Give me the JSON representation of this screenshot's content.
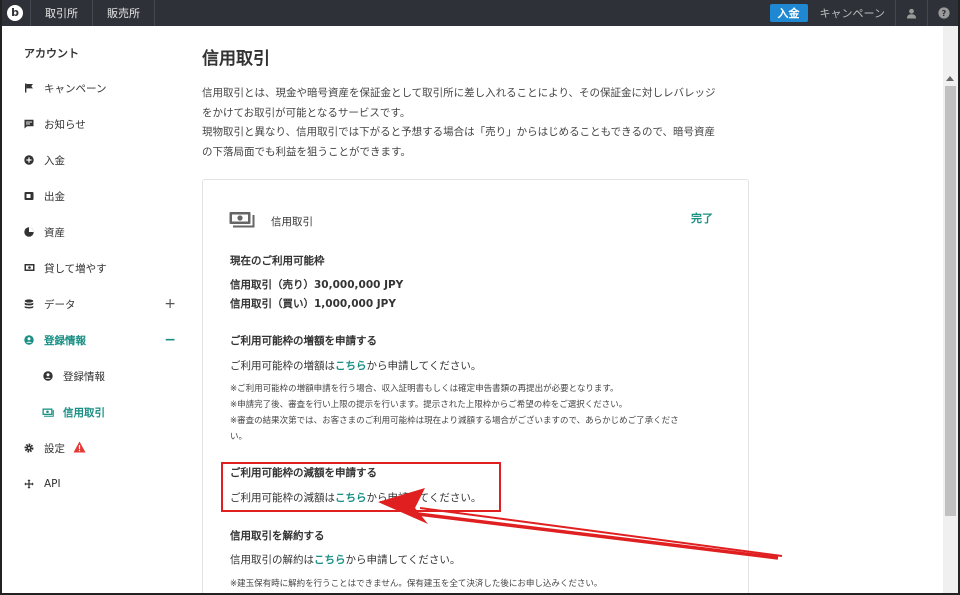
{
  "topnav": {
    "logo": "b",
    "tabs": [
      "取引所",
      "販売所"
    ],
    "deposit_button": "入金",
    "campaign_link": "キャンペーン",
    "icons": [
      "user-icon",
      "help-icon"
    ]
  },
  "sidebar": {
    "title": "アカウント",
    "items": [
      {
        "label": "キャンペーン",
        "icon": "flag-icon"
      },
      {
        "label": "お知らせ",
        "icon": "message-icon"
      },
      {
        "label": "入金",
        "icon": "plus-circle-icon"
      },
      {
        "label": "出金",
        "icon": "withdraw-icon"
      },
      {
        "label": "資産",
        "icon": "pie-chart-icon"
      },
      {
        "label": "貸して増やす",
        "icon": "lend-icon"
      },
      {
        "label": "データ",
        "icon": "database-icon",
        "expand": "+"
      },
      {
        "label": "登録情報",
        "icon": "user-circle-icon",
        "expand": "−"
      },
      {
        "label": "登録情報",
        "icon": "user-circle-icon"
      },
      {
        "label": "信用取引",
        "icon": "money-icon"
      },
      {
        "label": "設定",
        "icon": "gear-icon"
      },
      {
        "label": "API",
        "icon": "api-icon"
      }
    ]
  },
  "main": {
    "title": "信用取引",
    "intro": [
      "信用取引とは、現金や暗号資産を保証金として取引所に差し入れることにより、その保証金に対しレバレッジ",
      "をかけてお取引が可能となるサービスです。",
      "現物取引と異なり、信用取引では下がると予想する場合は「売り」からはじめることもできるので、暗号資産",
      "の下落局面でも利益を狙うことができます。"
    ],
    "card": {
      "label": "信用取引",
      "status": "完了",
      "limit_heading": "現在のご利用可能枠",
      "limit_sell": "信用取引（売り）30,000,000 JPY",
      "limit_buy": "信用取引（買い）1,000,000 JPY",
      "increase_heading": "ご利用可能枠の増額を申請する",
      "increase_pre": "ご利用可能枠の増額は",
      "increase_link": "こちら",
      "increase_post": "から申請してください。",
      "increase_notes": [
        "※ご利用可能枠の増額申請を行う場合、収入証明書もしくは確定申告書類の再提出が必要となります。",
        "※申請完了後、審査を行い上限の提示を行います。提示された上限枠からご希望の枠をご選択ください。",
        "※審査の結果次第では、お客さまのご利用可能枠は現在より減額する場合がございますので、あらかじめご了承くださ",
        "い。"
      ],
      "decrease_heading": "ご利用可能枠の減額を申請する",
      "decrease_pre": "ご利用可能枠の減額は",
      "decrease_link": "こちら",
      "decrease_post": "から申請してください。",
      "cancel_heading": "信用取引を解約する",
      "cancel_pre": "信用取引の解約は",
      "cancel_link": "こちら",
      "cancel_post": "から申請してください。",
      "cancel_note": "※建玉保有時に解約を行うことはできません。保有建玉を全て決済した後にお申し込みください。"
    }
  },
  "colors": {
    "nav_bg": "#2e3138",
    "accent": "#1a8f84",
    "deposit": "#1e88d3",
    "annotation": "#e02020"
  }
}
